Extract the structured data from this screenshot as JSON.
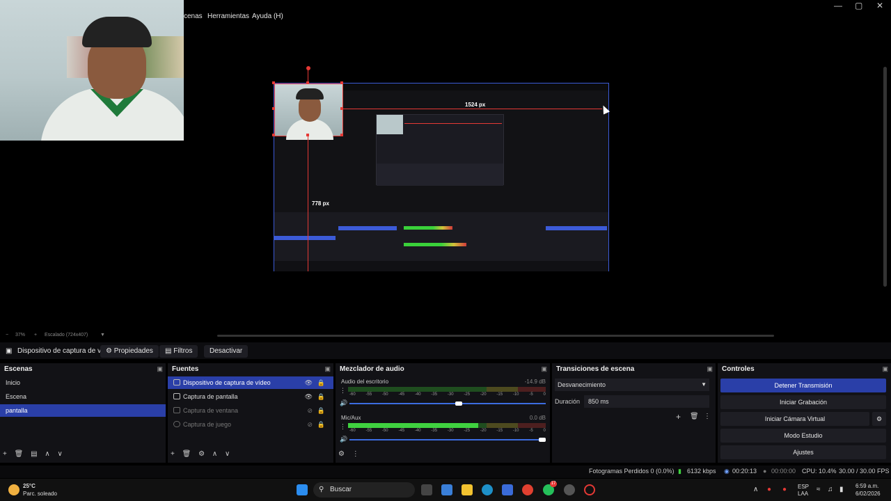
{
  "menu": {
    "items": [
      "cenas",
      "Herramientas",
      "Ayuda (H)"
    ]
  },
  "window": {
    "minimize": "—",
    "maximize": "▢",
    "close": "✕"
  },
  "preview": {
    "guide_h_label": "1524 px",
    "guide_v_label": "778 px"
  },
  "zoom": {
    "minus": "−",
    "level": "37%",
    "plus": "+",
    "scale": "Escalado (724x407)",
    "dropdown": "▼"
  },
  "context": {
    "source_name": "Dispositivo de captura de v",
    "properties": "Propiedades",
    "filters": "Filtros",
    "deactivate": "Desactivar"
  },
  "scenes": {
    "title": "Escenas",
    "items": [
      "Inicio",
      "Escena",
      "pantalla"
    ],
    "selected": "pantalla"
  },
  "sources": {
    "title": "Fuentes",
    "items": [
      {
        "label": "Dispositivo de captura de vídeo",
        "visible": true,
        "selected": true
      },
      {
        "label": "Captura de pantalla",
        "visible": true,
        "selected": false
      },
      {
        "label": "Captura de ventana",
        "visible": false,
        "selected": false
      },
      {
        "label": "Captura de juego",
        "visible": false,
        "selected": false
      }
    ]
  },
  "mixer": {
    "title": "Mezclador de audio",
    "channels": [
      {
        "name": "Audio del escritorio",
        "db": "-14.9 dB",
        "level": 0.0,
        "volume": 0.56
      },
      {
        "name": "Mic/Aux",
        "db": "0.0 dB",
        "level": 0.66,
        "volume": 1.0
      }
    ],
    "ticks": [
      "-60",
      "-55",
      "-50",
      "-45",
      "-40",
      "-35",
      "-30",
      "-25",
      "-20",
      "-15",
      "-10",
      "-5",
      "0"
    ]
  },
  "transitions": {
    "title": "Transiciones de escena",
    "selected": "Desvanecimiento",
    "duration_label": "Duración",
    "duration_value": "850 ms"
  },
  "controls": {
    "title": "Controles",
    "buttons": [
      "Detener Transmisión",
      "Iniciar Grabación",
      "Iniciar Cámara Virtual",
      "Modo Estudio",
      "Ajustes"
    ]
  },
  "status": {
    "dropped": "Fotogramas Perdidos 0 (0.0%)",
    "bitrate": "6132 kbps",
    "stream_time": "00:20:13",
    "rec_time": "00:00:00",
    "cpu": "CPU: 10.4%",
    "fps": "30.00 / 30.00 FPS"
  },
  "taskbar": {
    "weather_temp": "25°C",
    "weather_desc": "Parc. soleado",
    "search": "Buscar",
    "lang1": "ESP",
    "lang2": "LAA",
    "time": "6:59 a.m.",
    "date": "6/02/2026",
    "badge": "17"
  },
  "colors": {
    "accent": "#2a3fa8",
    "guide": "#e53935",
    "meter_green": "#3fd13f"
  }
}
